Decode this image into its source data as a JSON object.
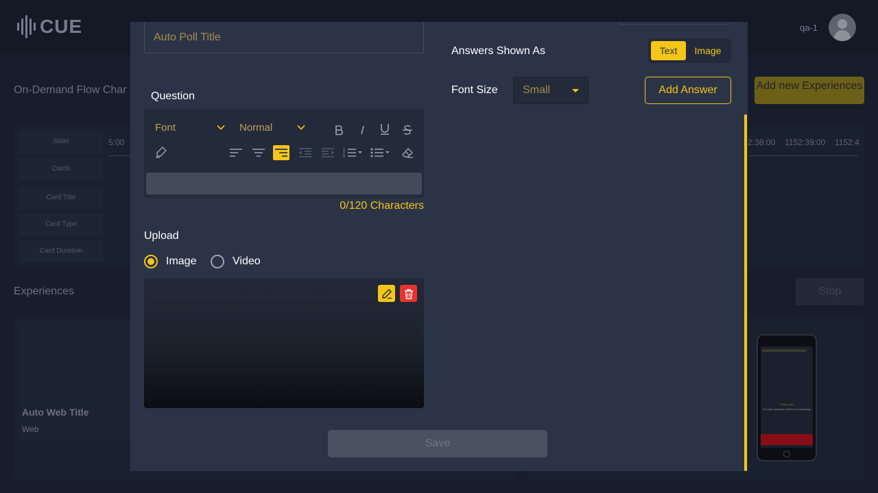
{
  "app": {
    "logo_text": "CUE",
    "username": "qa-1"
  },
  "background": {
    "flow_title": "On-Demand Flow Char",
    "add_experience_label": "Add new Experiences",
    "row_labels": [
      "State",
      "Cards",
      "Card Title",
      "Card Type",
      "Card Duration"
    ],
    "timeline": [
      "5:00",
      "2:38:00",
      "1152:39:00",
      "1152:4"
    ],
    "experiences_title": "Experiences",
    "stop_label": "Stop",
    "card": {
      "title": "Auto Web Title",
      "subtitle": "Web"
    },
    "phone": {
      "title": "Thank you!",
      "text": "You have completed, thanks for participating!"
    }
  },
  "modal": {
    "title_input": {
      "placeholder": "Auto Poll Title",
      "value": ""
    },
    "question": {
      "label": "Question",
      "toolbar": {
        "font_select": "Font",
        "size_select": "Normal"
      },
      "editor_value": "",
      "char_count": "0/120 Characters"
    },
    "upload": {
      "label": "Upload",
      "options": [
        "Image",
        "Video"
      ],
      "selected": "Image"
    },
    "answers_shown_as": {
      "label": "Answers Shown As",
      "options": [
        "Text",
        "Image"
      ],
      "selected": "Text"
    },
    "font_size": {
      "label": "Font Size",
      "value": "Small"
    },
    "add_answer_label": "Add Answer",
    "save_label": "Save"
  },
  "colors": {
    "accent": "#f5c518",
    "modal_bg": "#2b3447",
    "danger": "#e8322c"
  }
}
